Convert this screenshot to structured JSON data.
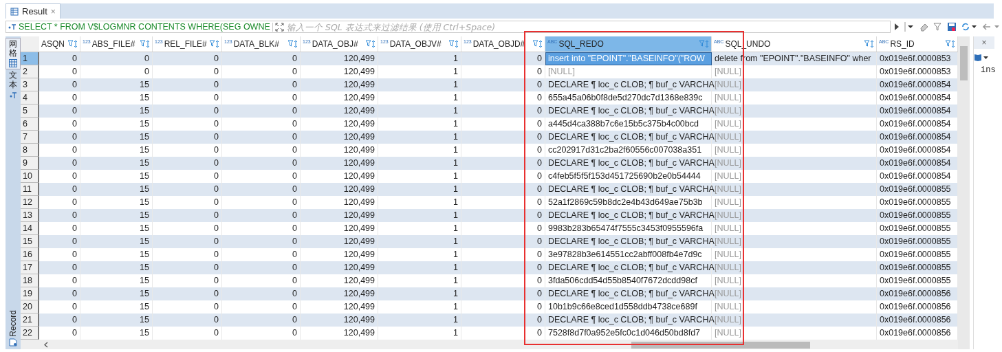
{
  "tab": {
    "title": "Result",
    "close": "×"
  },
  "filter": {
    "query": "SELECT * FROM V$LOGMNR CONTENTS WHERE(SEG OWNE",
    "placeholder": "输入一个 SQL 表达式来过滤结果 (使用 Ctrl+Space)"
  },
  "side_tabs": [
    {
      "label": "网格",
      "selected": true
    },
    {
      "label": "文本",
      "selected": false
    }
  ],
  "record_label": "Record",
  "columns": [
    {
      "name": "ASQN",
      "selected": false
    },
    {
      "name": "ABS_FILE#",
      "type_label": "123",
      "selected": false
    },
    {
      "name": "REL_FILE#",
      "type_label": "123",
      "selected": false
    },
    {
      "name": "DATA_BLK#",
      "type_label": "123",
      "selected": false
    },
    {
      "name": "DATA_OBJ#",
      "type_label": "123",
      "selected": false
    },
    {
      "name": "DATA_OBJV#",
      "type_label": "123",
      "selected": false
    },
    {
      "name": "DATA_OBJD#",
      "type_label": "123",
      "selected": false
    },
    {
      "name": "SQL_REDO",
      "type_label": "ABC",
      "selected": true
    },
    {
      "name": "SQL_UNDO",
      "type_label": "ABC",
      "selected": false
    },
    {
      "name": "RS_ID",
      "type_label": "ABC",
      "selected": false
    }
  ],
  "rows": [
    {
      "number": "1",
      "selected": true,
      "cells": [
        "0",
        "0",
        "0",
        "0",
        "120,499",
        "1",
        "0"
      ],
      "sql_redo": {
        "text": "insert into \"EPOINT\".\"BASEINFO\"(\"ROW",
        "null": false
      },
      "sql_undo": {
        "text": "delete from \"EPOINT\".\"BASEINFO\" wher",
        "null": false
      },
      "rs_id": "0x019e6f.0000853"
    },
    {
      "number": "2",
      "selected": false,
      "cells": [
        "0",
        "0",
        "0",
        "0",
        "120,499",
        "1",
        "0"
      ],
      "sql_redo": {
        "text": "[NULL]",
        "null": true
      },
      "sql_undo": {
        "text": "[NULL]",
        "null": true
      },
      "rs_id": "0x019e6f.0000853"
    },
    {
      "number": "3",
      "selected": false,
      "cells": [
        "0",
        "15",
        "0",
        "0",
        "120,499",
        "1",
        "0"
      ],
      "sql_redo": {
        "text": "DECLARE ¶ loc_c CLOB; ¶ buf_c VARCHA",
        "null": false
      },
      "sql_undo": {
        "text": "[NULL]",
        "null": true
      },
      "rs_id": "0x019e6f.0000854"
    },
    {
      "number": "4",
      "selected": false,
      "cells": [
        "0",
        "15",
        "0",
        "0",
        "120,499",
        "1",
        "0"
      ],
      "sql_redo": {
        "text": "655a45a06b0f8de5d270dc7d1368e839c",
        "null": false
      },
      "sql_undo": {
        "text": "[NULL]",
        "null": true
      },
      "rs_id": "0x019e6f.0000854"
    },
    {
      "number": "5",
      "selected": false,
      "cells": [
        "0",
        "15",
        "0",
        "0",
        "120,499",
        "1",
        "0"
      ],
      "sql_redo": {
        "text": "DECLARE ¶ loc_c CLOB; ¶ buf_c VARCHA",
        "null": false
      },
      "sql_undo": {
        "text": "[NULL]",
        "null": true
      },
      "rs_id": "0x019e6f.0000854"
    },
    {
      "number": "6",
      "selected": false,
      "cells": [
        "0",
        "15",
        "0",
        "0",
        "120,499",
        "1",
        "0"
      ],
      "sql_redo": {
        "text": "a445d4ca388b7c6e15b5c375b4c00bcd",
        "null": false
      },
      "sql_undo": {
        "text": "[NULL]",
        "null": true
      },
      "rs_id": "0x019e6f.0000854"
    },
    {
      "number": "7",
      "selected": false,
      "cells": [
        "0",
        "15",
        "0",
        "0",
        "120,499",
        "1",
        "0"
      ],
      "sql_redo": {
        "text": "DECLARE ¶ loc_c CLOB; ¶ buf_c VARCHA",
        "null": false
      },
      "sql_undo": {
        "text": "[NULL]",
        "null": true
      },
      "rs_id": "0x019e6f.0000854"
    },
    {
      "number": "8",
      "selected": false,
      "cells": [
        "0",
        "15",
        "0",
        "0",
        "120,499",
        "1",
        "0"
      ],
      "sql_redo": {
        "text": "cc202917d31c2ba2f60556c007038a351",
        "null": false
      },
      "sql_undo": {
        "text": "[NULL]",
        "null": true
      },
      "rs_id": "0x019e6f.0000854"
    },
    {
      "number": "9",
      "selected": false,
      "cells": [
        "0",
        "15",
        "0",
        "0",
        "120,499",
        "1",
        "0"
      ],
      "sql_redo": {
        "text": "DECLARE ¶ loc_c CLOB; ¶ buf_c VARCHA",
        "null": false
      },
      "sql_undo": {
        "text": "[NULL]",
        "null": true
      },
      "rs_id": "0x019e6f.0000854"
    },
    {
      "number": "10",
      "selected": false,
      "cells": [
        "0",
        "15",
        "0",
        "0",
        "120,499",
        "1",
        "0"
      ],
      "sql_redo": {
        "text": "c4feb5f5f5f153d451725690b2e0b54444",
        "null": false
      },
      "sql_undo": {
        "text": "[NULL]",
        "null": true
      },
      "rs_id": "0x019e6f.0000854"
    },
    {
      "number": "11",
      "selected": false,
      "cells": [
        "0",
        "15",
        "0",
        "0",
        "120,499",
        "1",
        "0"
      ],
      "sql_redo": {
        "text": "DECLARE ¶ loc_c CLOB; ¶ buf_c VARCHA",
        "null": false
      },
      "sql_undo": {
        "text": "[NULL]",
        "null": true
      },
      "rs_id": "0x019e6f.0000855"
    },
    {
      "number": "12",
      "selected": false,
      "cells": [
        "0",
        "15",
        "0",
        "0",
        "120,499",
        "1",
        "0"
      ],
      "sql_redo": {
        "text": "52a1f2869c59b8dc2e4b43d649ae75b3b",
        "null": false
      },
      "sql_undo": {
        "text": "[NULL]",
        "null": true
      },
      "rs_id": "0x019e6f.0000855"
    },
    {
      "number": "13",
      "selected": false,
      "cells": [
        "0",
        "15",
        "0",
        "0",
        "120,499",
        "1",
        "0"
      ],
      "sql_redo": {
        "text": "DECLARE ¶ loc_c CLOB; ¶ buf_c VARCHA",
        "null": false
      },
      "sql_undo": {
        "text": "[NULL]",
        "null": true
      },
      "rs_id": "0x019e6f.0000855"
    },
    {
      "number": "14",
      "selected": false,
      "cells": [
        "0",
        "15",
        "0",
        "0",
        "120,499",
        "1",
        "0"
      ],
      "sql_redo": {
        "text": "9983b283b65474f7555c3453f0955596fa",
        "null": false
      },
      "sql_undo": {
        "text": "[NULL]",
        "null": true
      },
      "rs_id": "0x019e6f.0000855"
    },
    {
      "number": "15",
      "selected": false,
      "cells": [
        "0",
        "15",
        "0",
        "0",
        "120,499",
        "1",
        "0"
      ],
      "sql_redo": {
        "text": "DECLARE ¶ loc_c CLOB; ¶ buf_c VARCHA",
        "null": false
      },
      "sql_undo": {
        "text": "[NULL]",
        "null": true
      },
      "rs_id": "0x019e6f.0000855"
    },
    {
      "number": "16",
      "selected": false,
      "cells": [
        "0",
        "15",
        "0",
        "0",
        "120,499",
        "1",
        "0"
      ],
      "sql_redo": {
        "text": "3e97828b3e614551cc2abff008fb4e7d9c",
        "null": false
      },
      "sql_undo": {
        "text": "[NULL]",
        "null": true
      },
      "rs_id": "0x019e6f.0000855"
    },
    {
      "number": "17",
      "selected": false,
      "cells": [
        "0",
        "15",
        "0",
        "0",
        "120,499",
        "1",
        "0"
      ],
      "sql_redo": {
        "text": "DECLARE ¶ loc_c CLOB; ¶ buf_c VARCHA",
        "null": false
      },
      "sql_undo": {
        "text": "[NULL]",
        "null": true
      },
      "rs_id": "0x019e6f.0000855"
    },
    {
      "number": "18",
      "selected": false,
      "cells": [
        "0",
        "15",
        "0",
        "0",
        "120,499",
        "1",
        "0"
      ],
      "sql_redo": {
        "text": "3fda506cdd54d55b8540f7672dcdd98cf",
        "null": false
      },
      "sql_undo": {
        "text": "[NULL]",
        "null": true
      },
      "rs_id": "0x019e6f.0000855"
    },
    {
      "number": "19",
      "selected": false,
      "cells": [
        "0",
        "15",
        "0",
        "0",
        "120,499",
        "1",
        "0"
      ],
      "sql_redo": {
        "text": "DECLARE ¶ loc_c CLOB; ¶ buf_c VARCHA",
        "null": false
      },
      "sql_undo": {
        "text": "[NULL]",
        "null": true
      },
      "rs_id": "0x019e6f.0000856"
    },
    {
      "number": "20",
      "selected": false,
      "cells": [
        "0",
        "15",
        "0",
        "0",
        "120,499",
        "1",
        "0"
      ],
      "sql_redo": {
        "text": "10b1b9c66e8ced1d558ddb4738ce689f",
        "null": false
      },
      "sql_undo": {
        "text": "[NULL]",
        "null": true
      },
      "rs_id": "0x019e6f.0000856"
    },
    {
      "number": "21",
      "selected": false,
      "cells": [
        "0",
        "15",
        "0",
        "0",
        "120,499",
        "1",
        "0"
      ],
      "sql_redo": {
        "text": "DECLARE ¶ loc_c CLOB; ¶ buf_c VARCHA",
        "null": false
      },
      "sql_undo": {
        "text": "[NULL]",
        "null": true
      },
      "rs_id": "0x019e6f.0000856"
    },
    {
      "number": "22",
      "selected": false,
      "cells": [
        "0",
        "15",
        "0",
        "0",
        "120,499",
        "1",
        "0"
      ],
      "sql_redo": {
        "text": "7528f8d7f0a952e5fc0c1d046d50bd8fd7",
        "null": false
      },
      "sql_undo": {
        "text": "[NULL]",
        "null": true
      },
      "rs_id": "0x019e6f.0000856"
    }
  ],
  "side_panel": {
    "close": "×",
    "text": "ins"
  }
}
